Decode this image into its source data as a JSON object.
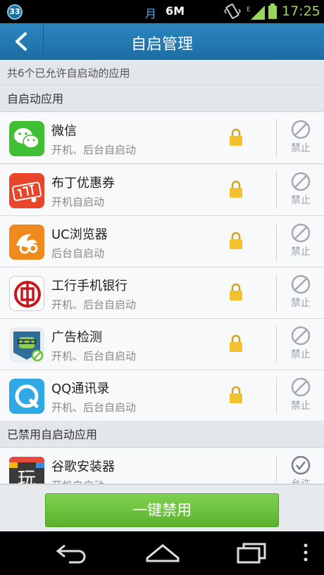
{
  "status_bar": {
    "badge": "33",
    "month": "月",
    "data": "6M",
    "network": "E",
    "time": "17:25"
  },
  "header": {
    "title": "自启管理"
  },
  "info": {
    "summary": "共6个已允许自启动的应用"
  },
  "sections": {
    "enabled_title": "自启动应用",
    "disabled_title": "已禁用自启动应用"
  },
  "apps_enabled": [
    {
      "name": "微信",
      "desc": "开机、后台自启动",
      "icon": "wechat-icon",
      "action": "禁止"
    },
    {
      "name": "布丁优惠券",
      "desc": "开机自启动",
      "icon": "budding-coupon-icon",
      "action": "禁止"
    },
    {
      "name": "UC浏览器",
      "desc": "后台自启动",
      "icon": "uc-browser-icon",
      "action": "禁止"
    },
    {
      "name": "工行手机银行",
      "desc": "开机、后台自启动",
      "icon": "icbc-bank-icon",
      "action": "禁止"
    },
    {
      "name": "广告检测",
      "desc": "开机、后台自启动",
      "icon": "ad-detector-icon",
      "action": "禁止"
    },
    {
      "name": "QQ通讯录",
      "desc": "开机、后台自启动",
      "icon": "qq-contacts-icon",
      "action": "禁止"
    }
  ],
  "apps_disabled": [
    {
      "name": "谷歌安装器",
      "desc": "开机自启动",
      "icon": "google-installer-icon",
      "action": "允许"
    }
  ],
  "bottom": {
    "disable_all": "一键禁用"
  },
  "colors": {
    "titlebar": "#1f78b0",
    "button_green": "#6cc13c",
    "lock_yellow": "#f2c12e"
  }
}
